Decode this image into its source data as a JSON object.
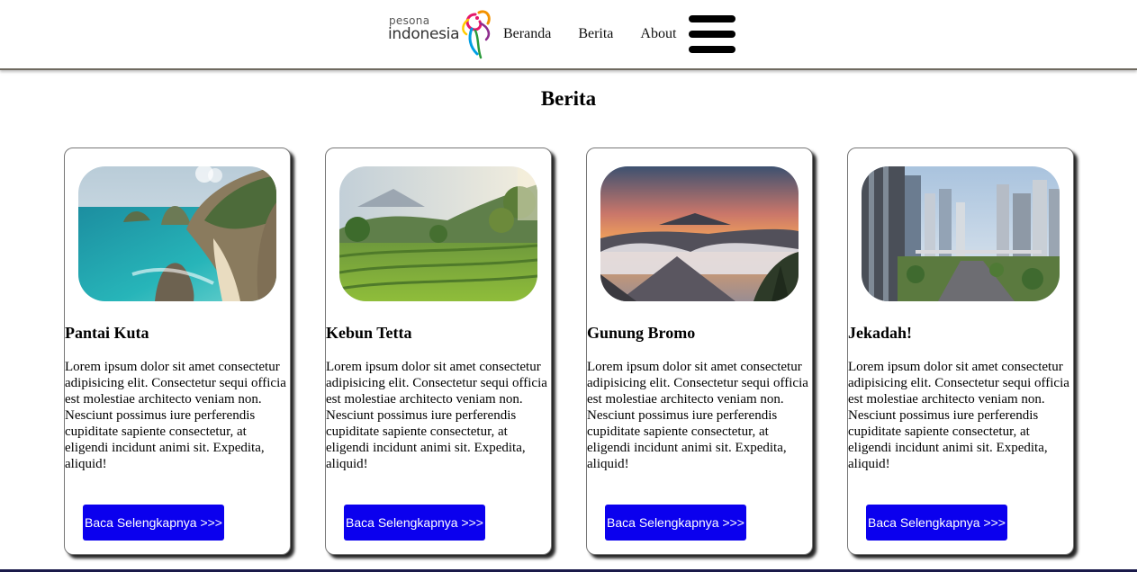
{
  "logo": {
    "small": "pesona",
    "big": "indonesia"
  },
  "nav": {
    "items": [
      "Beranda",
      "Berita",
      "About"
    ]
  },
  "section": {
    "title": "Berita"
  },
  "cards": [
    {
      "title": "Pantai Kuta",
      "desc": "Lorem ipsum dolor sit amet consectetur adipisicing elit. Consectetur sequi officia est molestiae architecto veniam non. Nesciunt possimus iure perferendis cupiditate sapiente consectetur, at eligendi incidunt animi sit. Expedita, aliquid!",
      "button": "Baca Selengkapnya >>>"
    },
    {
      "title": "Kebun Tetta",
      "desc": "Lorem ipsum dolor sit amet consectetur adipisicing elit. Consectetur sequi officia est molestiae architecto veniam non. Nesciunt possimus iure perferendis cupiditate sapiente consectetur, at eligendi incidunt animi sit. Expedita, aliquid!",
      "button": "Baca Selengkapnya >>>"
    },
    {
      "title": "Gunung Bromo",
      "desc": "Lorem ipsum dolor sit amet consectetur adipisicing elit. Consectetur sequi officia est molestiae architecto veniam non. Nesciunt possimus iure perferendis cupiditate sapiente consectetur, at eligendi incidunt animi sit. Expedita, aliquid!",
      "button": "Baca Selengkapnya >>>"
    },
    {
      "title": "Jekadah!",
      "desc": "Lorem ipsum dolor sit amet consectetur adipisicing elit. Consectetur sequi officia est molestiae architecto veniam non. Nesciunt possimus iure perferendis cupiditate sapiente consectetur, at eligendi incidunt animi sit. Expedita, aliquid!",
      "button": "Baca Selengkapnya >>>"
    }
  ],
  "colors": {
    "button": "#0b00ee",
    "button_text": "#ffffff"
  },
  "icons": {
    "menu": "hamburger-menu-icon"
  }
}
